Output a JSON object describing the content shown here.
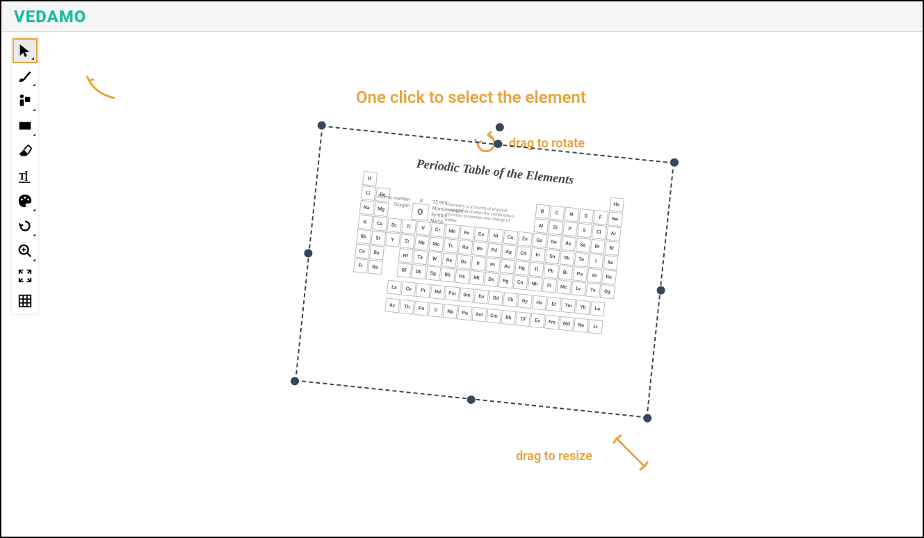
{
  "logo": "VEDAMO",
  "annotations": {
    "main": "One click to select the element",
    "rotate": "drag to rotate",
    "resize": "drag to resize"
  },
  "tools": [
    {
      "name": "pointer",
      "active": true
    },
    {
      "name": "brush",
      "active": false
    },
    {
      "name": "presenter",
      "active": false
    },
    {
      "name": "rectangle",
      "active": false
    },
    {
      "name": "eraser",
      "active": false
    },
    {
      "name": "text",
      "active": false
    },
    {
      "name": "palette",
      "active": false
    },
    {
      "name": "undo",
      "active": false
    },
    {
      "name": "zoom",
      "active": false
    },
    {
      "name": "fit",
      "active": false
    },
    {
      "name": "grid",
      "active": false
    }
  ],
  "periodic": {
    "title": "Periodic Table of the Elements",
    "legend": {
      "atomic_number_label": "Atomic number",
      "atomic_number_value": "8",
      "weight_label": "Atomic weight",
      "weight_value": "15.999",
      "symbol": "O",
      "symbol_label": "Symbol",
      "name_label": "Name",
      "name_value": "Oxygen",
      "description": "Chemistry is a branch of physical science that studies the composition, structure, properties and change of matter"
    },
    "rows": [
      [
        "H",
        "",
        "",
        "",
        "",
        "",
        "",
        "",
        "",
        "",
        "",
        "",
        "",
        "",
        "",
        "",
        "",
        "He"
      ],
      [
        "Li",
        "Be",
        "",
        "",
        "",
        "",
        "",
        "",
        "",
        "",
        "",
        "",
        "B",
        "C",
        "N",
        "O",
        "F",
        "Ne"
      ],
      [
        "Na",
        "Mg",
        "",
        "",
        "",
        "",
        "",
        "",
        "",
        "",
        "",
        "",
        "Al",
        "Si",
        "P",
        "S",
        "Cl",
        "Ar"
      ],
      [
        "K",
        "Ca",
        "Sc",
        "Ti",
        "V",
        "Cr",
        "Mn",
        "Fe",
        "Co",
        "Ni",
        "Cu",
        "Zn",
        "Ga",
        "Ge",
        "As",
        "Se",
        "Br",
        "Kr"
      ],
      [
        "Rb",
        "Sr",
        "Y",
        "Zr",
        "Nb",
        "Mo",
        "Tc",
        "Ru",
        "Rh",
        "Pd",
        "Ag",
        "Cd",
        "In",
        "Sn",
        "Sb",
        "Te",
        "I",
        "Xe"
      ],
      [
        "Cs",
        "Ba",
        "",
        "Hf",
        "Ta",
        "W",
        "Re",
        "Os",
        "Ir",
        "Pt",
        "Au",
        "Hg",
        "Tl",
        "Pb",
        "Bi",
        "Po",
        "At",
        "Rn"
      ],
      [
        "Fr",
        "Ra",
        "",
        "Rf",
        "Db",
        "Sg",
        "Bh",
        "Hs",
        "Mt",
        "Ds",
        "Rg",
        "Cn",
        "Nh",
        "Fl",
        "Mc",
        "Lv",
        "Ts",
        "Og"
      ]
    ],
    "lanthanides": [
      "La",
      "Ce",
      "Pr",
      "Nd",
      "Pm",
      "Sm",
      "Eu",
      "Gd",
      "Tb",
      "Dy",
      "Ho",
      "Er",
      "Tm",
      "Yb",
      "Lu"
    ],
    "actinides": [
      "Ac",
      "Th",
      "Pa",
      "U",
      "Np",
      "Pu",
      "Am",
      "Cm",
      "Bk",
      "Cf",
      "Es",
      "Fm",
      "Md",
      "No",
      "Lr"
    ]
  },
  "colors": {
    "accent": "#e8a33d",
    "brand": "#1abc9c"
  }
}
